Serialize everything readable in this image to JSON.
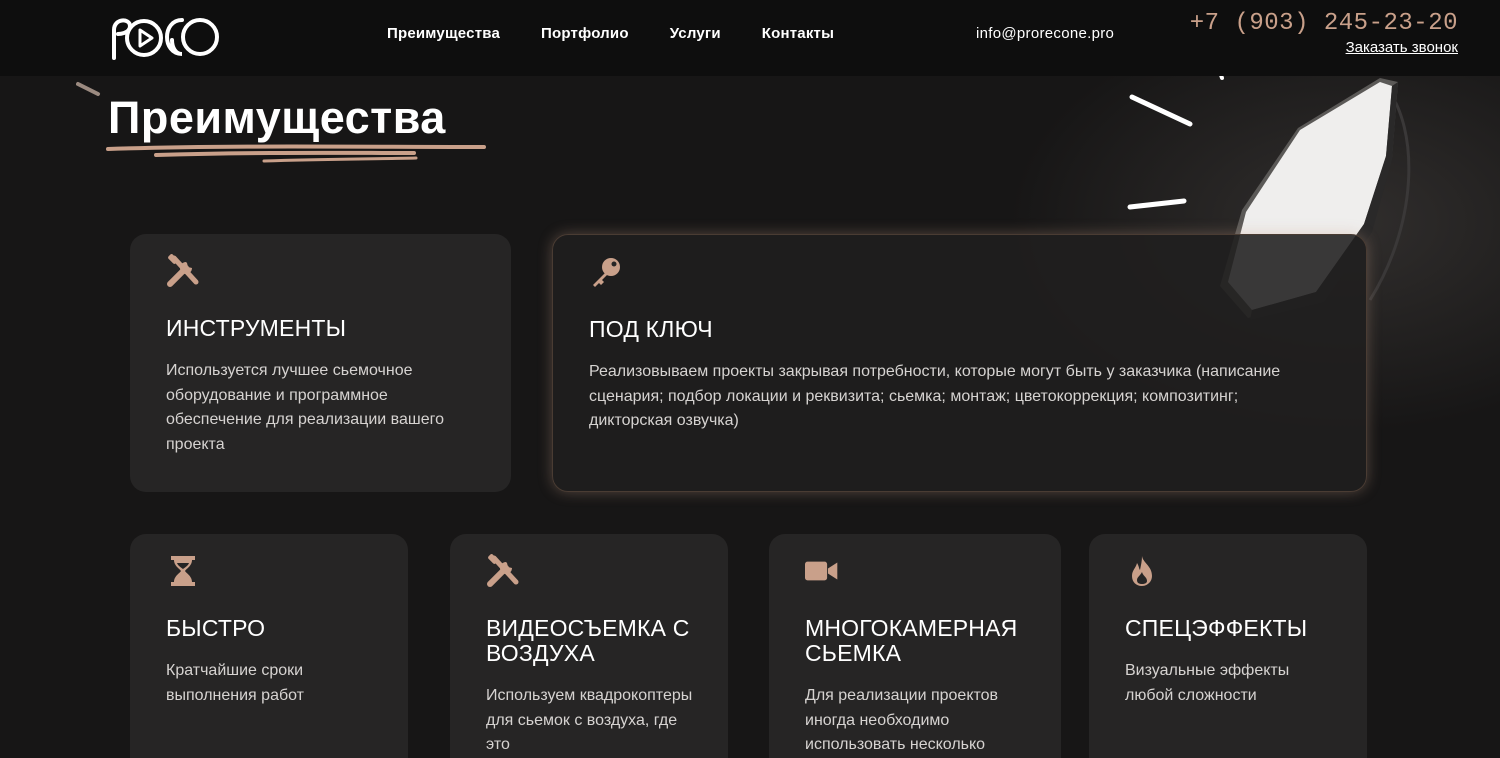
{
  "header": {
    "logo_text": "PRO",
    "nav": [
      {
        "label": "Преимущества"
      },
      {
        "label": "Портфолио"
      },
      {
        "label": "Услуги"
      },
      {
        "label": "Контакты"
      }
    ],
    "email": "info@prorecone.pro",
    "phone": "+7 (903) 245-23-20",
    "callback": "Заказать звонок"
  },
  "section": {
    "title": "Преимущества"
  },
  "colors": {
    "accent": "#c9a08a",
    "background": "#171616",
    "card": "#262525",
    "header": "#0e0e0e"
  },
  "cards": [
    {
      "icon": "tools-icon",
      "title": "ИНСТРУМЕНТЫ",
      "text": "Используется лучшее сьемочное оборудование и программное обеспечение для реализации вашего проекта"
    },
    {
      "icon": "key-icon",
      "title": "ПОД КЛЮЧ",
      "text": "Реализовываем проекты закрывая потребности, которые могут быть у заказчика (написание сценария; подбор локации и реквизита; сьемка; монтаж; цветокоррекция; композитинг; дикторская озвучка)"
    },
    {
      "icon": "hourglass-icon",
      "title": "БЫСТРО",
      "text": "Кратчайшие сроки выполнения работ"
    },
    {
      "icon": "tools-icon",
      "title": "ВИДЕОСЪЕМКА С ВОЗДУХА",
      "text": "Используем квадрокоптеры для сьемок с воздуха, где это"
    },
    {
      "icon": "video-camera-icon",
      "title": "МНОГОКАМЕРНАЯ СЬЕМКА",
      "text": "Для реализации проектов иногда необходимо использовать несколько"
    },
    {
      "icon": "fire-icon",
      "title": "СПЕЦЭФФЕКТЫ",
      "text": "Визуальные эффекты любой сложности"
    }
  ]
}
